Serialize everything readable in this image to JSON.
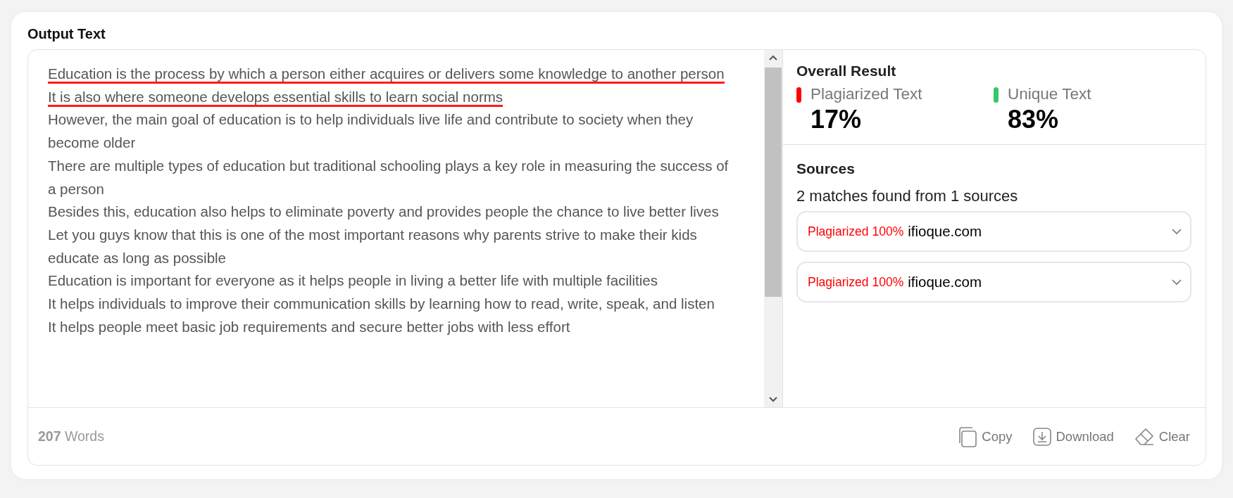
{
  "title": "Output Text",
  "sentences": [
    {
      "text": "Education is the process by which a person either acquires or delivers some knowledge to another person",
      "plagiarized": true
    },
    {
      "text": "It is also where someone develops essential skills to learn social norms",
      "plagiarized": true
    },
    {
      "text": "However, the main goal of education is to help individuals live life and contribute to society when they become older",
      "plagiarized": false
    },
    {
      "text": "There are multiple types of education but traditional schooling plays a key role in measuring the success of a person",
      "plagiarized": false
    },
    {
      "text": "Besides this, education also helps to eliminate poverty and provides people the chance to live better lives",
      "plagiarized": false
    },
    {
      "text": "Let you guys know that this is one of the most important reasons why parents strive to make their kids educate as long as possible",
      "plagiarized": false
    },
    {
      "text": "Education is important for everyone as it helps people in living a better life with multiple facilities",
      "plagiarized": false
    },
    {
      "text": "It helps individuals to improve their communication skills by learning how to read, write, speak, and listen",
      "plagiarized": false
    },
    {
      "text": "It helps people meet basic job requirements and secure better jobs with less effort",
      "plagiarized": false
    }
  ],
  "overall": {
    "heading": "Overall Result",
    "stats": [
      {
        "label": "Plagiarized Text",
        "value": "17%",
        "color": "#ff0000"
      },
      {
        "label": "Unique Text",
        "value": "83%",
        "color": "#34c76b"
      }
    ]
  },
  "sources": {
    "heading": "Sources",
    "summary": "2 matches found from 1 sources",
    "items": [
      {
        "status": "Plagiarized 100%",
        "domain": "ifioque.com",
        "expanded": false
      },
      {
        "status": "Plagiarized 100%",
        "domain": "ifioque.com",
        "expanded": false
      }
    ]
  },
  "word_count": "**207** Words",
  "actions": [
    {
      "kind": "copy",
      "label": "Copy"
    },
    {
      "kind": "download",
      "label": "Download"
    },
    {
      "kind": "clear",
      "label": "Clear"
    }
  ]
}
